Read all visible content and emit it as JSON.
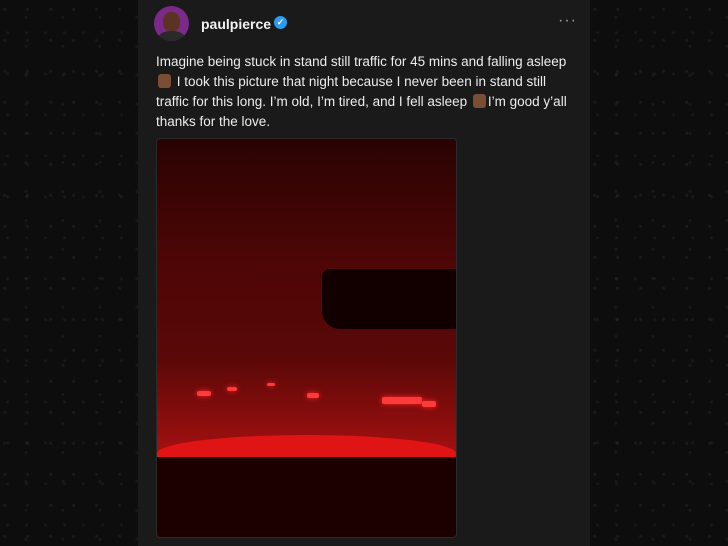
{
  "post": {
    "username": "paulpierce",
    "more_label": "···",
    "caption_1": "Imagine being stuck in stand still traffic for 45 mins and falling asleep",
    "caption_2": "I took this picture that night because I never been in stand still traffic for this long. I’m old, I’m tired, and I fell asleep",
    "caption_3": "I’m good y’all thanks for the love."
  },
  "icons": {
    "verified": "verified-badge-icon",
    "more": "more-options-icon",
    "emoji_1": "man-facepalming-emoji",
    "emoji_2": "man-shrugging-emoji"
  },
  "colors": {
    "background": "#0e0e0e",
    "card": "#1a1a1a",
    "text": "#ededed",
    "verified": "#2d9cf0"
  }
}
